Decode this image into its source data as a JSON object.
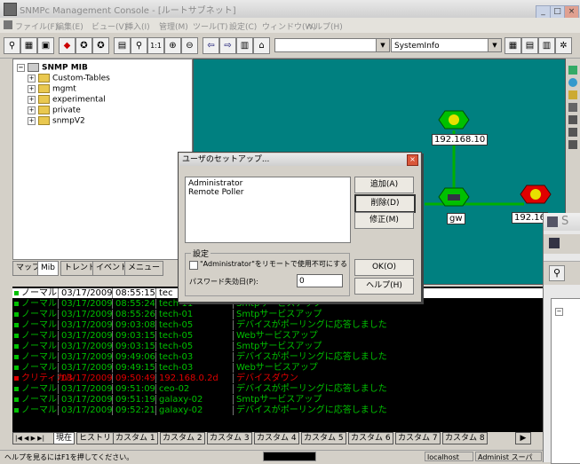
{
  "window": {
    "title": "SNMPc Management Console - [ルートサブネット]",
    "minimize": "_",
    "maximize": "□",
    "close": "×"
  },
  "menu": [
    "ファイル(F)",
    "編集(E)",
    "ビュー(V)",
    "挿入(I)",
    "管理(M)",
    "ツール(T)",
    "設定(C)",
    "ウィンドウ(W)",
    "ヘルプ(H)"
  ],
  "toolbar": {
    "combo_value": "SystemInfo",
    "zoom_label": "1:1"
  },
  "tree": {
    "root": "SNMP MIB",
    "items": [
      "Custom-Tables",
      "mgmt",
      "experimental",
      "private",
      "snmpV2"
    ]
  },
  "left_tabs": [
    "マップ",
    "Mib",
    "トレンド",
    "イベント",
    "メニュー"
  ],
  "map": {
    "nodes": [
      {
        "label": "192.168.10"
      },
      {
        "label": "gw"
      },
      {
        "label": "192.16"
      }
    ],
    "colors": {
      "background": "#008080",
      "link": "#00b000",
      "ok": "#00c000",
      "critical": "#e00000"
    }
  },
  "dialog": {
    "title": "ユーザのセットアップ...",
    "users": [
      "Administrator",
      "Remote Poller"
    ],
    "buttons": {
      "add": "追加(A)",
      "delete": "削除(D)",
      "edit": "修正(M)",
      "ok": "OK(O)",
      "help": "ヘルプ(H)"
    },
    "settings_label": "設定",
    "checkbox_label": "\"Administrator\"をリモートで使用不可にする",
    "password_label": "パスワード失効日(P):",
    "password_value": "0"
  },
  "log": {
    "rows": [
      {
        "sev": "ノーマル",
        "date": "03/17/2009",
        "time": "08:55:15",
        "src": "tec",
        "msg": "",
        "color": "#000000",
        "bg": "#ffffff"
      },
      {
        "sev": "ノーマル",
        "date": "03/17/2009",
        "time": "08:55:24",
        "src": "tech-11",
        "msg": "Smtpサービスアップ",
        "color": "#00c000",
        "bg": "#000000"
      },
      {
        "sev": "ノーマル",
        "date": "03/17/2009",
        "time": "08:55:26",
        "src": "tech-01",
        "msg": "Smtpサービスアップ",
        "color": "#00c000",
        "bg": "#000000"
      },
      {
        "sev": "ノーマル",
        "date": "03/17/2009",
        "time": "09:03:08",
        "src": "tech-05",
        "msg": "デバイスがポーリングに応答しました",
        "color": "#00c000",
        "bg": "#000000"
      },
      {
        "sev": "ノーマル",
        "date": "03/17/2009",
        "time": "09:03:15",
        "src": "tech-05",
        "msg": "Webサービスアップ",
        "color": "#00c000",
        "bg": "#000000"
      },
      {
        "sev": "ノーマル",
        "date": "03/17/2009",
        "time": "09:03:15",
        "src": "tech-05",
        "msg": "Smtpサービスアップ",
        "color": "#00c000",
        "bg": "#000000"
      },
      {
        "sev": "ノーマル",
        "date": "03/17/2009",
        "time": "09:49:06",
        "src": "tech-03",
        "msg": "デバイスがポーリングに応答しました",
        "color": "#00c000",
        "bg": "#000000"
      },
      {
        "sev": "ノーマル",
        "date": "03/17/2009",
        "time": "09:49:15",
        "src": "tech-03",
        "msg": "Webサービスアップ",
        "color": "#00c000",
        "bg": "#000000"
      },
      {
        "sev": "クリティカル",
        "date": "03/17/2009",
        "time": "09:50:49",
        "src": "192.168.0.2d",
        "msg": "デバイスダウン",
        "color": "#e00000",
        "bg": "#000000"
      },
      {
        "sev": "ノーマル",
        "date": "03/17/2009",
        "time": "09:51:09",
        "src": "ceo-02",
        "msg": "デバイスがポーリングに応答しました",
        "color": "#00c000",
        "bg": "#000000"
      },
      {
        "sev": "ノーマル",
        "date": "03/17/2009",
        "time": "09:51:19",
        "src": "galaxy-02",
        "msg": "Smtpサービスアップ",
        "color": "#00c000",
        "bg": "#000000"
      },
      {
        "sev": "ノーマル",
        "date": "03/17/2009",
        "time": "09:52:21",
        "src": "galaxy-02",
        "msg": "デバイスがポーリングに応答しました",
        "color": "#00c000",
        "bg": "#000000"
      }
    ]
  },
  "bottom_tabs": [
    "現在",
    "ヒストリ",
    "カスタム 1",
    "カスタム 2",
    "カスタム 3",
    "カスタム 4",
    "カスタム 5",
    "カスタム 6",
    "カスタム 7",
    "カスタム 8"
  ],
  "status": {
    "help": "ヘルプを見るにはF1を押してください。",
    "host": "localhost",
    "user": "Administ スーパ"
  },
  "second_window": {
    "title_fragment": "S"
  }
}
